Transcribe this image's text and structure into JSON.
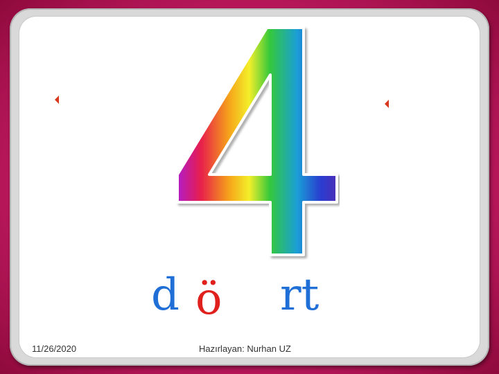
{
  "slide": {
    "digit": "4",
    "word_parts": [
      "d",
      "ö",
      "rt"
    ],
    "date": "11/26/2020",
    "author": "Hazırlayan: Nurhan UZ"
  },
  "colors": {
    "background": "#c8175e",
    "letter_blue": "#1f6fd6",
    "letter_red": "#e0201c",
    "bullet": "#d9381e"
  },
  "icons": [
    "bullet-arrow-icon",
    "rainbow-four-graphic"
  ]
}
